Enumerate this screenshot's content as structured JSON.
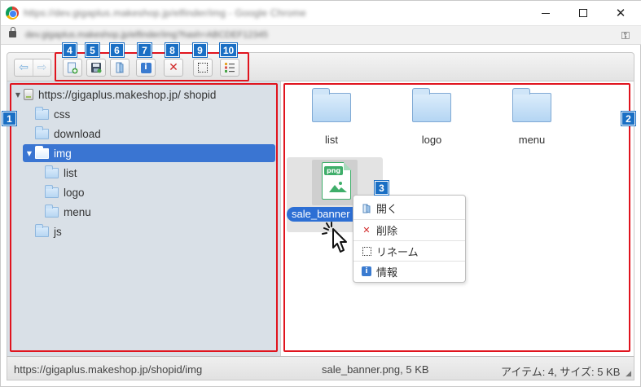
{
  "browser": {
    "title": "https://dev.gigaplus.makeshop.jp/elfinder/img - Google Chrome",
    "url": "dev.gigaplus.makeshop.jp/elfinder/img?hash=ABCDEF12345",
    "min_icon": "window-minimize",
    "max_icon": "window-maximize",
    "close_label": "✕"
  },
  "toolbar": {
    "back_label": "⇦",
    "forward_label": "⇨",
    "buttons": [
      {
        "badge": "4",
        "icon": "upload-icon"
      },
      {
        "badge": "5",
        "icon": "download-icon"
      },
      {
        "badge": "6",
        "icon": "open-icon"
      },
      {
        "badge": "7",
        "icon": "info-icon",
        "glyph": "i"
      },
      {
        "badge": "8",
        "icon": "delete-icon",
        "glyph": "✕"
      },
      {
        "badge": "9",
        "icon": "rename-icon"
      },
      {
        "badge": "10",
        "icon": "view-list-icon"
      }
    ]
  },
  "tree": {
    "badge": "1",
    "root": "https://gigaplus.makeshop.jp/ shopid",
    "items": [
      {
        "label": "css",
        "level": 1,
        "selected": false
      },
      {
        "label": "download",
        "level": 1,
        "selected": false
      },
      {
        "label": "img",
        "level": 1,
        "selected": true,
        "expanded": true
      },
      {
        "label": "list",
        "level": 2,
        "selected": false
      },
      {
        "label": "logo",
        "level": 2,
        "selected": false
      },
      {
        "label": "menu",
        "level": 2,
        "selected": false
      },
      {
        "label": "js",
        "level": 1,
        "selected": false
      }
    ]
  },
  "content": {
    "badge": "2",
    "folders": [
      "list",
      "logo",
      "menu"
    ],
    "file": {
      "name": "sale_banner",
      "type_tag": "png"
    }
  },
  "context_menu": {
    "badge": "3",
    "items": [
      {
        "label": "開く",
        "icon": "open-icon"
      },
      {
        "label": "削除",
        "icon": "delete-icon"
      },
      {
        "label": "リネーム",
        "icon": "rename-icon"
      },
      {
        "label": "情報",
        "icon": "info-icon"
      }
    ]
  },
  "statusbar": {
    "path": "https://gigaplus.makeshop.jp/shopid/img",
    "selection": "sale_banner.png, 5 KB",
    "summary": "アイテム: 4, サイズ: 5 KB"
  },
  "colors": {
    "highlight_red": "#e0141e",
    "badge_blue": "#1a6fc4",
    "selection_blue": "#3a75d2"
  }
}
